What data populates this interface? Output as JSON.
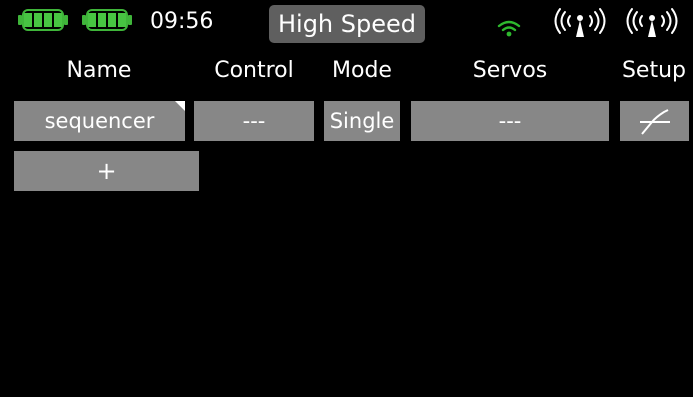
{
  "status_bar": {
    "battery_1_icon": "battery-full-icon",
    "battery_2_icon": "battery-full-icon",
    "time": "09:56",
    "flight_mode": "High Speed",
    "signal_icon": "wifi-signal-icon",
    "antenna_1_icon": "antenna-icon",
    "antenna_2_icon": "antenna-icon",
    "battery_color": "#3fb53a",
    "signal_color": "#2eb82e"
  },
  "columns": {
    "name": "Name",
    "control": "Control",
    "mode": "Mode",
    "servos": "Servos",
    "setup": "Setup"
  },
  "rows": [
    {
      "name": "sequencer",
      "control": "---",
      "mode": "Single",
      "servos": "---",
      "setup_icon": "curve-setup-icon"
    }
  ],
  "add_button_label": "+",
  "colors": {
    "background": "#000000",
    "cell": "#878787",
    "header_pill": "#5f5f5f",
    "text": "#ffffff"
  }
}
